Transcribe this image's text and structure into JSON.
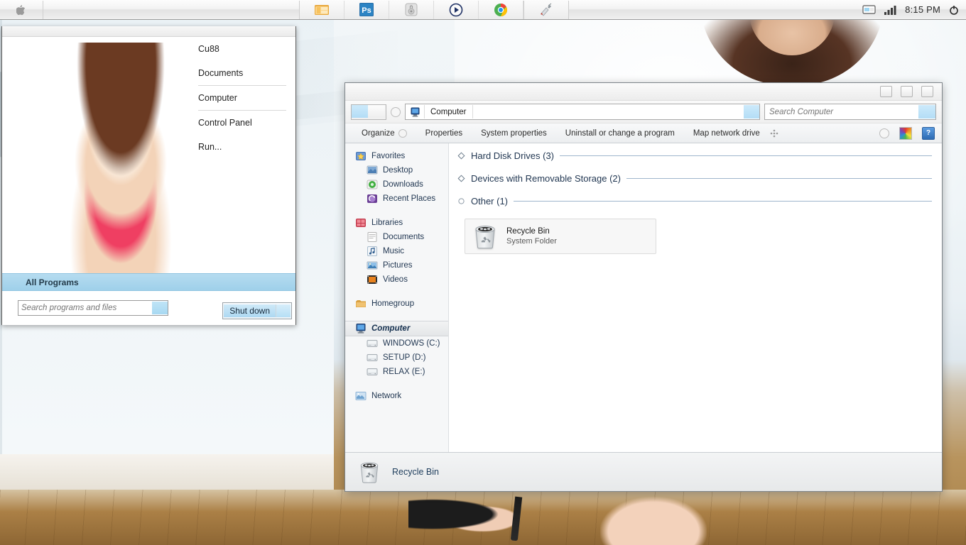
{
  "taskbar": {
    "start_icon": "apple-logo-icon",
    "apps": [
      {
        "name": "windows-explorer-taskbar-icon",
        "label": "Windows Explorer"
      },
      {
        "name": "photoshop-taskbar-icon",
        "label": "Ps"
      },
      {
        "name": "media-device-taskbar-icon",
        "label": "Media Device"
      },
      {
        "name": "media-player-taskbar-icon",
        "label": "Media Player"
      },
      {
        "name": "google-chrome-taskbar-icon",
        "label": "Google Chrome"
      },
      {
        "name": "paint-tool-taskbar-icon",
        "label": "Paint Tool"
      }
    ],
    "tray": {
      "show_desktop_icon": "monitor-icon",
      "network_icon": "signal-bars-icon",
      "time": "8:15 PM",
      "power_icon": "power-icon"
    }
  },
  "start_menu": {
    "items": [
      {
        "label": "Cu88",
        "sep_after": false
      },
      {
        "label": "Documents",
        "sep_after": true
      },
      {
        "label": "Computer",
        "sep_after": true
      },
      {
        "label": "Control Panel",
        "sep_after": false
      },
      {
        "label": "Run...",
        "sep_after": false
      }
    ],
    "all_programs_label": "All Programs",
    "search_placeholder": "Search programs and files",
    "search_value": "",
    "shutdown_label": "Shut down"
  },
  "explorer": {
    "window_controls": [
      "minimize-button",
      "maximize-button",
      "close-button"
    ],
    "breadcrumb": "Computer",
    "breadcrumb_icon": "computer-icon",
    "search_placeholder": "Search Computer",
    "search_value": "",
    "toolbar": [
      {
        "label": "Organize",
        "has_caret": true
      },
      {
        "label": "Properties",
        "has_caret": false
      },
      {
        "label": "System properties",
        "has_caret": false
      },
      {
        "label": "Uninstall or change a program",
        "has_caret": false
      },
      {
        "label": "Map network drive",
        "has_caret": false
      }
    ],
    "toolbar_right": {
      "dots_icon": "drag-dots-icon",
      "circle_icon": "view-circle-icon",
      "rainbow_icon": "change-view-icon",
      "help_label": "?"
    },
    "sidebar": [
      {
        "label": "Favorites",
        "icon": "favorites-star-icon",
        "level": 0,
        "gap_after": false
      },
      {
        "label": "Desktop",
        "icon": "desktop-icon",
        "level": 1,
        "gap_after": false
      },
      {
        "label": "Downloads",
        "icon": "downloads-icon",
        "level": 1,
        "gap_after": false
      },
      {
        "label": "Recent Places",
        "icon": "recent-places-icon",
        "level": 1,
        "gap_after": true
      },
      {
        "label": "Libraries",
        "icon": "libraries-icon",
        "level": 0,
        "gap_after": false
      },
      {
        "label": "Documents",
        "icon": "documents-library-icon",
        "level": 1,
        "gap_after": false
      },
      {
        "label": "Music",
        "icon": "music-library-icon",
        "level": 1,
        "gap_after": false
      },
      {
        "label": "Pictures",
        "icon": "pictures-library-icon",
        "level": 1,
        "gap_after": false
      },
      {
        "label": "Videos",
        "icon": "videos-library-icon",
        "level": 1,
        "gap_after": true
      },
      {
        "label": "Homegroup",
        "icon": "homegroup-icon",
        "level": 0,
        "gap_after": true
      },
      {
        "label": "Computer",
        "icon": "computer-icon",
        "level": 0,
        "gap_after": false,
        "selected": true
      },
      {
        "label": "WINDOWS (C:)",
        "icon": "hard-drive-icon",
        "level": 1,
        "gap_after": false
      },
      {
        "label": "SETUP (D:)",
        "icon": "hard-drive-icon",
        "level": 1,
        "gap_after": false
      },
      {
        "label": "RELAX (E:)",
        "icon": "hard-drive-icon",
        "level": 1,
        "gap_after": true
      },
      {
        "label": "Network",
        "icon": "network-icon",
        "level": 0,
        "gap_after": false
      }
    ],
    "groups": [
      {
        "label": "Hard Disk Drives (3)",
        "expander": "collapsed-diamond",
        "items": []
      },
      {
        "label": "Devices with Removable Storage (2)",
        "expander": "collapsed-diamond",
        "items": []
      },
      {
        "label": "Other (1)",
        "expander": "expanded-circle",
        "items": [
          {
            "name": "Recycle Bin",
            "subtitle": "System Folder",
            "icon": "recycle-bin-icon"
          }
        ]
      }
    ],
    "status": {
      "selected_name": "Recycle Bin",
      "icon": "recycle-bin-icon"
    }
  },
  "colors": {
    "accent_blue": "#b3ddf6",
    "allprograms_blue": "#9fd0ea",
    "group_label": "#1f3550",
    "group_line": "#9fb6cc"
  }
}
